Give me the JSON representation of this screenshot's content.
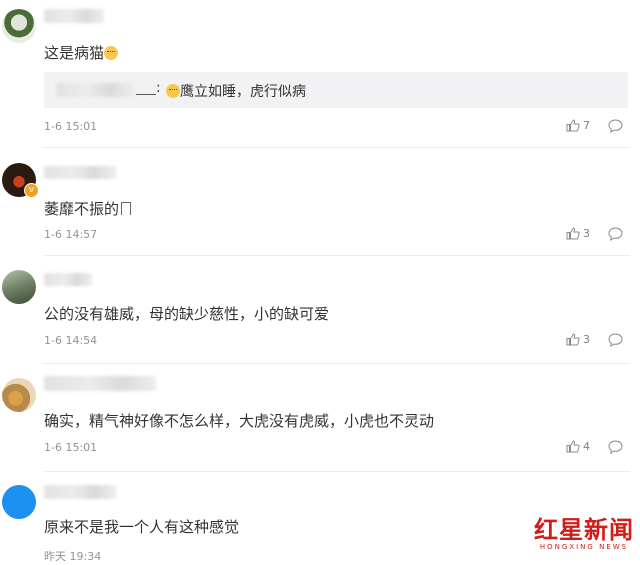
{
  "comments": [
    {
      "text": "这是病猫",
      "emoji": "cat-face",
      "reply_quote": "鹰立如睡，虎行似病",
      "time": "1-6 15:01",
      "likes": "7",
      "avatar_color": "#4b6b3a"
    },
    {
      "text": "萎靡不振的",
      "time": "1-6 14:57",
      "likes": "3",
      "avatar_color": "#2b1a12"
    },
    {
      "text": "公的没有雄威，母的缺少慈性，小的缺可爱",
      "time": "1-6 14:54",
      "likes": "3",
      "avatar_color": "#6f7f64"
    },
    {
      "text": "确实，精气神好像不怎么样，大虎没有虎威，小虎也不灵动",
      "time": "1-6 15:01",
      "likes": "4",
      "avatar_color": "#b9894a"
    },
    {
      "text": "原来不是我一个人有这种感觉",
      "time": "昨天 19:34",
      "likes": "",
      "avatar_color": "#1e90f0"
    }
  ],
  "watermark": {
    "text": "红星新闻",
    "sub": "HONGXING NEWS"
  },
  "icons": {
    "like": "thumbs-up-icon",
    "reply": "comment-bubble-icon",
    "verified": "verified-badge-icon"
  }
}
